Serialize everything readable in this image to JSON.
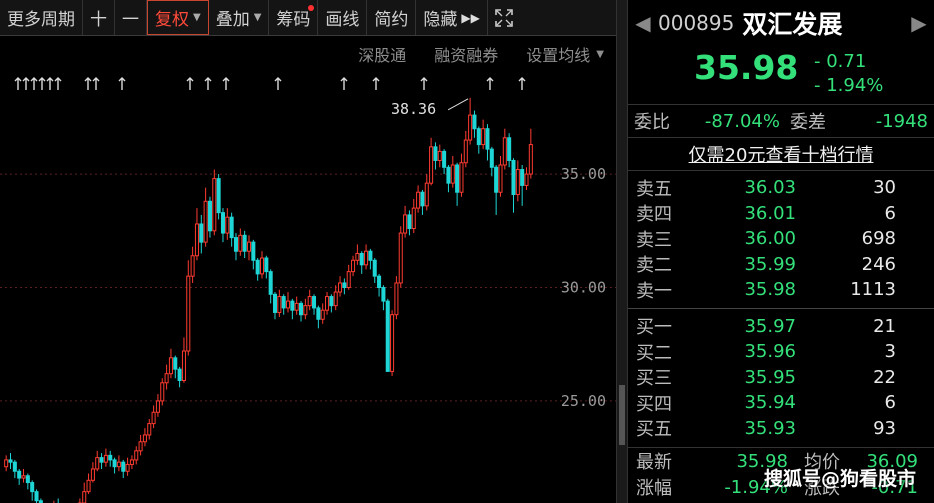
{
  "toolbar": {
    "more_period": "更多周期",
    "plus": "十",
    "minus": "一",
    "fuquan": "复权",
    "diejia": "叠加",
    "chouma": "筹码",
    "huaxian": "画线",
    "jianyue": "简约",
    "yincang": "隐藏"
  },
  "subbar": {
    "shengutong": "深股通",
    "rongzi": "融资融券",
    "junxian": "设置均线"
  },
  "chart_data": {
    "type": "candlestick",
    "y_ticks": [
      "35.00",
      "30.00",
      "25.00"
    ],
    "ylim": [
      20.5,
      39.5
    ],
    "high_label": "38.36",
    "candles": [
      [
        22.1,
        22.4,
        22.6,
        21.9
      ],
      [
        22.4,
        22.3,
        22.7,
        22.0
      ],
      [
        22.3,
        21.9,
        22.4,
        21.6
      ],
      [
        21.9,
        21.6,
        22.0,
        21.3
      ],
      [
        21.6,
        21.7,
        22.0,
        21.4
      ],
      [
        21.7,
        21.4,
        21.8,
        21.1
      ],
      [
        21.4,
        21.0,
        21.5,
        20.6
      ],
      [
        21.0,
        20.6,
        21.1,
        20.3
      ],
      [
        20.6,
        19.5,
        20.7,
        19.2
      ],
      [
        19.5,
        19.7,
        20.0,
        19.0
      ],
      [
        19.7,
        19.9,
        20.3,
        19.5
      ],
      [
        19.9,
        20.4,
        20.6,
        19.8
      ],
      [
        20.4,
        20.2,
        20.7,
        20.0
      ],
      [
        20.2,
        20.0,
        20.4,
        19.7
      ],
      [
        20.0,
        20.3,
        20.5,
        19.9
      ],
      [
        20.3,
        20.1,
        20.4,
        19.8
      ],
      [
        20.1,
        19.8,
        20.2,
        19.5
      ],
      [
        19.8,
        20.5,
        20.7,
        19.7
      ],
      [
        20.5,
        21.0,
        21.4,
        20.4
      ],
      [
        21.0,
        21.5,
        21.8,
        20.9
      ],
      [
        21.5,
        22.0,
        22.3,
        21.4
      ],
      [
        22.0,
        22.5,
        22.8,
        21.9
      ],
      [
        22.5,
        22.3,
        22.7,
        22.0
      ],
      [
        22.3,
        22.6,
        22.9,
        22.1
      ],
      [
        22.6,
        22.4,
        22.8,
        22.1
      ],
      [
        22.4,
        22.1,
        22.5,
        21.8
      ],
      [
        22.1,
        22.3,
        22.6,
        21.9
      ],
      [
        22.3,
        21.9,
        22.4,
        21.6
      ],
      [
        21.9,
        22.2,
        22.5,
        21.7
      ],
      [
        22.2,
        22.4,
        22.6,
        22.0
      ],
      [
        22.4,
        22.8,
        23.0,
        22.2
      ],
      [
        22.8,
        23.2,
        23.5,
        22.6
      ],
      [
        23.2,
        23.5,
        23.8,
        23.0
      ],
      [
        23.5,
        24.0,
        24.2,
        23.3
      ],
      [
        24.0,
        24.5,
        24.8,
        23.8
      ],
      [
        24.5,
        25.0,
        25.3,
        24.3
      ],
      [
        25.0,
        25.8,
        26.0,
        24.8
      ],
      [
        25.8,
        26.2,
        26.6,
        25.5
      ],
      [
        26.2,
        26.9,
        27.3,
        26.0
      ],
      [
        26.9,
        26.4,
        27.0,
        26.0
      ],
      [
        26.4,
        25.9,
        26.5,
        25.6
      ],
      [
        25.9,
        27.2,
        27.8,
        25.8
      ],
      [
        27.2,
        30.5,
        31.2,
        27.0
      ],
      [
        30.5,
        31.4,
        31.8,
        30.2
      ],
      [
        31.4,
        32.8,
        33.5,
        31.2
      ],
      [
        32.8,
        32.0,
        33.2,
        31.5
      ],
      [
        32.0,
        33.8,
        34.4,
        31.8
      ],
      [
        33.8,
        32.5,
        34.0,
        32.2
      ],
      [
        32.5,
        34.8,
        35.2,
        32.3
      ],
      [
        34.8,
        33.3,
        35.0,
        33.0
      ],
      [
        33.3,
        32.4,
        33.5,
        32.0
      ],
      [
        32.4,
        33.1,
        33.5,
        32.1
      ],
      [
        33.1,
        32.2,
        33.3,
        31.8
      ],
      [
        32.2,
        31.6,
        32.4,
        31.2
      ],
      [
        31.6,
        32.3,
        32.6,
        31.4
      ],
      [
        32.3,
        31.6,
        32.5,
        31.3
      ],
      [
        31.6,
        32.0,
        32.3,
        31.2
      ],
      [
        32.0,
        31.2,
        32.1,
        30.8
      ],
      [
        31.2,
        30.6,
        31.3,
        30.3
      ],
      [
        30.6,
        31.3,
        31.6,
        30.4
      ],
      [
        31.3,
        30.7,
        31.4,
        30.4
      ],
      [
        30.7,
        29.7,
        30.8,
        29.3
      ],
      [
        29.7,
        28.9,
        29.8,
        28.6
      ],
      [
        28.9,
        29.6,
        29.9,
        28.7
      ],
      [
        29.6,
        29.1,
        29.7,
        28.8
      ],
      [
        29.1,
        29.4,
        29.8,
        28.9
      ],
      [
        29.4,
        29.0,
        29.5,
        28.6
      ],
      [
        29.0,
        29.3,
        29.6,
        28.8
      ],
      [
        29.3,
        28.8,
        29.4,
        28.5
      ],
      [
        28.8,
        29.2,
        29.5,
        28.6
      ],
      [
        29.2,
        29.6,
        29.9,
        29.0
      ],
      [
        29.6,
        29.1,
        29.7,
        28.8
      ],
      [
        29.1,
        28.6,
        29.2,
        28.2
      ],
      [
        28.6,
        29.0,
        29.3,
        28.4
      ],
      [
        29.0,
        29.6,
        29.8,
        28.8
      ],
      [
        29.6,
        29.2,
        29.7,
        28.9
      ],
      [
        29.2,
        29.8,
        30.1,
        29.0
      ],
      [
        29.8,
        30.2,
        30.5,
        29.6
      ],
      [
        30.2,
        30.0,
        30.4,
        29.7
      ],
      [
        30.0,
        30.7,
        31.0,
        29.9
      ],
      [
        30.7,
        31.2,
        31.4,
        30.5
      ],
      [
        31.2,
        31.5,
        31.9,
        31.0
      ],
      [
        31.5,
        31.0,
        31.6,
        30.6
      ],
      [
        31.0,
        31.6,
        31.9,
        30.8
      ],
      [
        31.6,
        31.2,
        31.7,
        30.8
      ],
      [
        31.2,
        30.5,
        31.3,
        30.2
      ],
      [
        30.5,
        30.0,
        30.6,
        29.6
      ],
      [
        30.0,
        29.4,
        30.1,
        29.0
      ],
      [
        29.4,
        26.3,
        29.5,
        26.3
      ],
      [
        26.3,
        28.8,
        29.0,
        26.1
      ],
      [
        28.8,
        30.2,
        30.5,
        28.6
      ],
      [
        30.2,
        32.4,
        32.7,
        30.0
      ],
      [
        32.4,
        33.2,
        33.6,
        32.2
      ],
      [
        33.2,
        32.6,
        33.4,
        32.3
      ],
      [
        32.6,
        33.5,
        33.9,
        32.4
      ],
      [
        33.5,
        34.2,
        34.5,
        33.3
      ],
      [
        34.2,
        33.6,
        34.3,
        33.2
      ],
      [
        33.6,
        34.6,
        35.0,
        33.4
      ],
      [
        34.6,
        36.2,
        36.6,
        34.5
      ],
      [
        36.2,
        35.6,
        36.4,
        35.2
      ],
      [
        35.6,
        36.0,
        36.3,
        35.3
      ],
      [
        36.0,
        35.3,
        36.1,
        35.0
      ],
      [
        35.3,
        34.6,
        35.4,
        34.2
      ],
      [
        34.6,
        35.4,
        35.8,
        34.4
      ],
      [
        35.4,
        34.2,
        35.5,
        33.6
      ],
      [
        34.2,
        35.5,
        35.9,
        34.0
      ],
      [
        35.5,
        36.5,
        36.9,
        35.3
      ],
      [
        36.5,
        37.6,
        38.36,
        36.3
      ],
      [
        37.6,
        37.0,
        37.8,
        36.6
      ],
      [
        37.0,
        36.3,
        37.1,
        35.9
      ],
      [
        36.3,
        37.0,
        37.4,
        36.1
      ],
      [
        37.0,
        36.1,
        37.2,
        35.6
      ],
      [
        36.1,
        35.3,
        36.2,
        34.9
      ],
      [
        35.3,
        34.2,
        35.4,
        33.2
      ],
      [
        34.2,
        35.4,
        35.8,
        34.0
      ],
      [
        35.4,
        36.6,
        37.0,
        35.2
      ],
      [
        36.6,
        35.6,
        36.8,
        35.3
      ],
      [
        35.6,
        34.1,
        35.7,
        33.3
      ],
      [
        34.1,
        35.2,
        35.6,
        33.8
      ],
      [
        35.2,
        34.5,
        35.4,
        33.6
      ],
      [
        34.5,
        35.0,
        35.3,
        34.3
      ],
      [
        35.0,
        36.3,
        37.0,
        34.8
      ]
    ]
  },
  "quote": {
    "code": "000895",
    "name": "双汇发展",
    "price": "35.98",
    "change": "- 0.71",
    "change_pct": "- 1.94%",
    "weibi_label": "委比",
    "weibi": "-87.04%",
    "weicha_label": "委差",
    "weicha": "-1948",
    "promo": "仅需20元查看十档行情"
  },
  "asks": [
    {
      "label": "卖五",
      "price": "36.03",
      "vol": "30"
    },
    {
      "label": "卖四",
      "price": "36.01",
      "vol": "6"
    },
    {
      "label": "卖三",
      "price": "36.00",
      "vol": "698"
    },
    {
      "label": "卖二",
      "price": "35.99",
      "vol": "246"
    },
    {
      "label": "卖一",
      "price": "35.98",
      "vol": "1113"
    }
  ],
  "bids": [
    {
      "label": "买一",
      "price": "35.97",
      "vol": "21"
    },
    {
      "label": "买二",
      "price": "35.96",
      "vol": "3"
    },
    {
      "label": "买三",
      "price": "35.95",
      "vol": "22"
    },
    {
      "label": "买四",
      "price": "35.94",
      "vol": "6"
    },
    {
      "label": "买五",
      "price": "35.93",
      "vol": "93"
    }
  ],
  "stats": {
    "latest_label": "最新",
    "latest": "35.98",
    "avg_label": "均价",
    "avg": "36.09",
    "zhangfu_label": "涨幅",
    "zhangfu": "-1.94%",
    "zhangdie_label": "涨跌",
    "zhangdie": "-0.71"
  },
  "watermark": "搜狐号@狗看股市",
  "colors": {
    "up": "#ff3b30",
    "down": "#1fd6d6",
    "green": "#34e07a",
    "bg": "#000000"
  }
}
